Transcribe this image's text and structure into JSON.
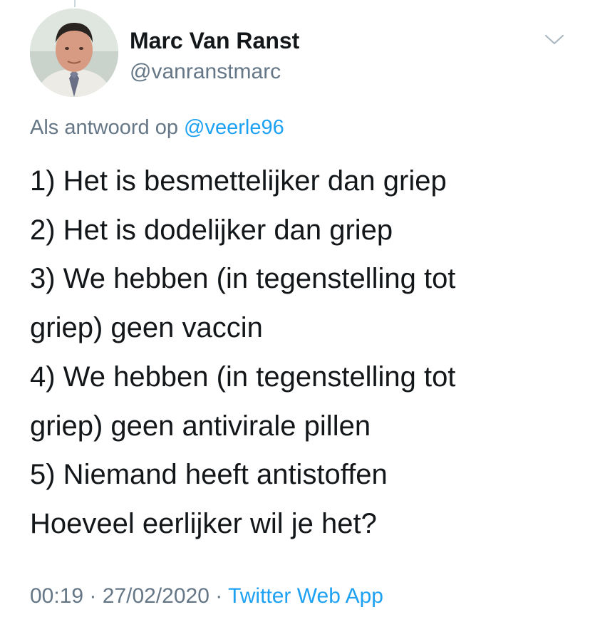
{
  "author": {
    "name": "Marc Van Ranst",
    "handle": "@vanranstmarc",
    "avatar_icon": "profile-photo-avatar"
  },
  "reply": {
    "prefix": "Als antwoord op",
    "mention": "@veerle96"
  },
  "tweet": {
    "lines": [
      "1) Het is besmettelijker dan griep",
      "2) Het is dodelijker dan griep",
      "3) We hebben (in tegenstelling tot",
      "griep) geen vaccin",
      "4) We hebben (in tegenstelling tot",
      "griep) geen antivirale pillen",
      "5) Niemand heeft antistoffen",
      "Hoeveel eerlijker wil je het?"
    ]
  },
  "meta": {
    "time": "00:19",
    "separator": "·",
    "date": "27/02/2020",
    "source": "Twitter Web App"
  },
  "icons": {
    "menu": "chevron-down-icon"
  },
  "colors": {
    "text": "#14171a",
    "secondary": "#657786",
    "link": "#1da1f2",
    "background": "#ffffff"
  }
}
